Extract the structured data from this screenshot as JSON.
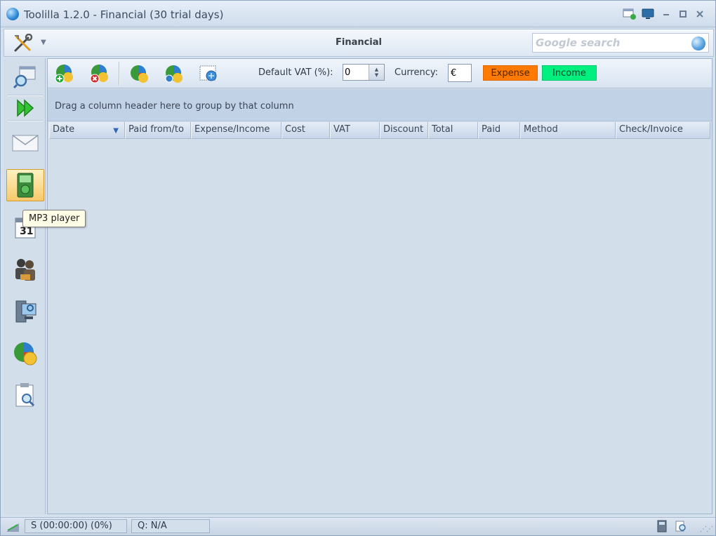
{
  "window": {
    "title": "Toolilla 1.2.0 - Financial (30 trial days)"
  },
  "header": {
    "title": "Financial",
    "search_placeholder": "Google search"
  },
  "tooltip": {
    "text": "MP3 player"
  },
  "toolbar": {
    "vat_label": "Default VAT (%):",
    "vat_value": "0",
    "currency_label": "Currency:",
    "currency_value": "€",
    "expense_label": "Expense",
    "income_label": "Income"
  },
  "grid": {
    "group_hint": "Drag a column header here to group by that column",
    "columns": [
      "Date",
      "Paid from/to",
      "Expense/Income",
      "Cost",
      "VAT",
      "Discount",
      "Total",
      "Paid",
      "Method",
      "Check/Invoice"
    ]
  },
  "statusbar": {
    "session": "S (00:00:00) (0%)",
    "queue": "Q: N/A"
  },
  "colors": {
    "expense": "#ff7a00",
    "income": "#00f080",
    "active_sidebar": "#f7c96a"
  },
  "icons": {
    "sidebar": [
      "search-window-icon",
      "forward-arrows-icon",
      "mail-icon",
      "mp3-player-icon",
      "calendar-icon",
      "contacts-icon",
      "computer-icon",
      "financial-pie-icon",
      "clipboard-search-icon"
    ],
    "toolbar": [
      "add-entry-icon",
      "delete-entry-icon",
      "edit-entry-icon",
      "copy-entry-icon",
      "print-preview-icon"
    ]
  }
}
